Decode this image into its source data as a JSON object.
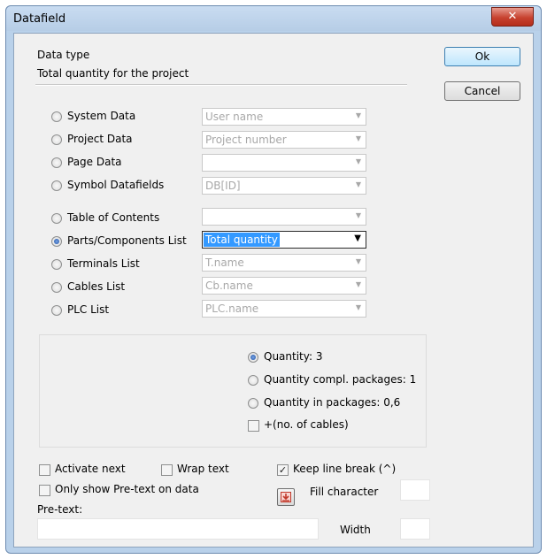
{
  "window": {
    "title": "Datafield",
    "close_glyph": "✕"
  },
  "buttons": {
    "ok": "Ok",
    "cancel": "Cancel"
  },
  "datatype": {
    "heading": "Data type",
    "subheading": "Total quantity for the project"
  },
  "radio_options": [
    {
      "label": "System Data",
      "combo_value": "User name",
      "checked": false
    },
    {
      "label": "Project Data",
      "combo_value": "Project number",
      "checked": false
    },
    {
      "label": "Page Data",
      "combo_value": "",
      "checked": false
    },
    {
      "label": "Symbol Datafields",
      "combo_value": "DB[ID]",
      "checked": false
    },
    {
      "label": "Table of Contents",
      "combo_value": "",
      "checked": false
    },
    {
      "label": "Parts/Components List",
      "combo_value": "Total quantity",
      "checked": true
    },
    {
      "label": "Terminals List",
      "combo_value": "T.name",
      "checked": false
    },
    {
      "label": "Cables List",
      "combo_value": "Cb.name",
      "checked": false
    },
    {
      "label": "PLC List",
      "combo_value": "PLC.name",
      "checked": false
    }
  ],
  "quantity_options": [
    {
      "label": "Quantity: 3",
      "checked": true
    },
    {
      "label": "Quantity compl. packages: 1",
      "checked": false
    },
    {
      "label": "Quantity in packages: 0,6",
      "checked": false
    }
  ],
  "cables_checkbox": {
    "label": "+(no. of cables)",
    "checked": false
  },
  "options": {
    "activate_next": "Activate next",
    "wrap_text": "Wrap text",
    "keep_line_break": "Keep line break (^)",
    "only_show_pretext": "Only show Pre-text on data",
    "fill_character": "Fill character",
    "pre_text": "Pre-text:",
    "width": "Width"
  },
  "colors": {
    "selection": "#3399ff",
    "window_frame": "#b9d1ea",
    "close_button": "#c7422f"
  }
}
